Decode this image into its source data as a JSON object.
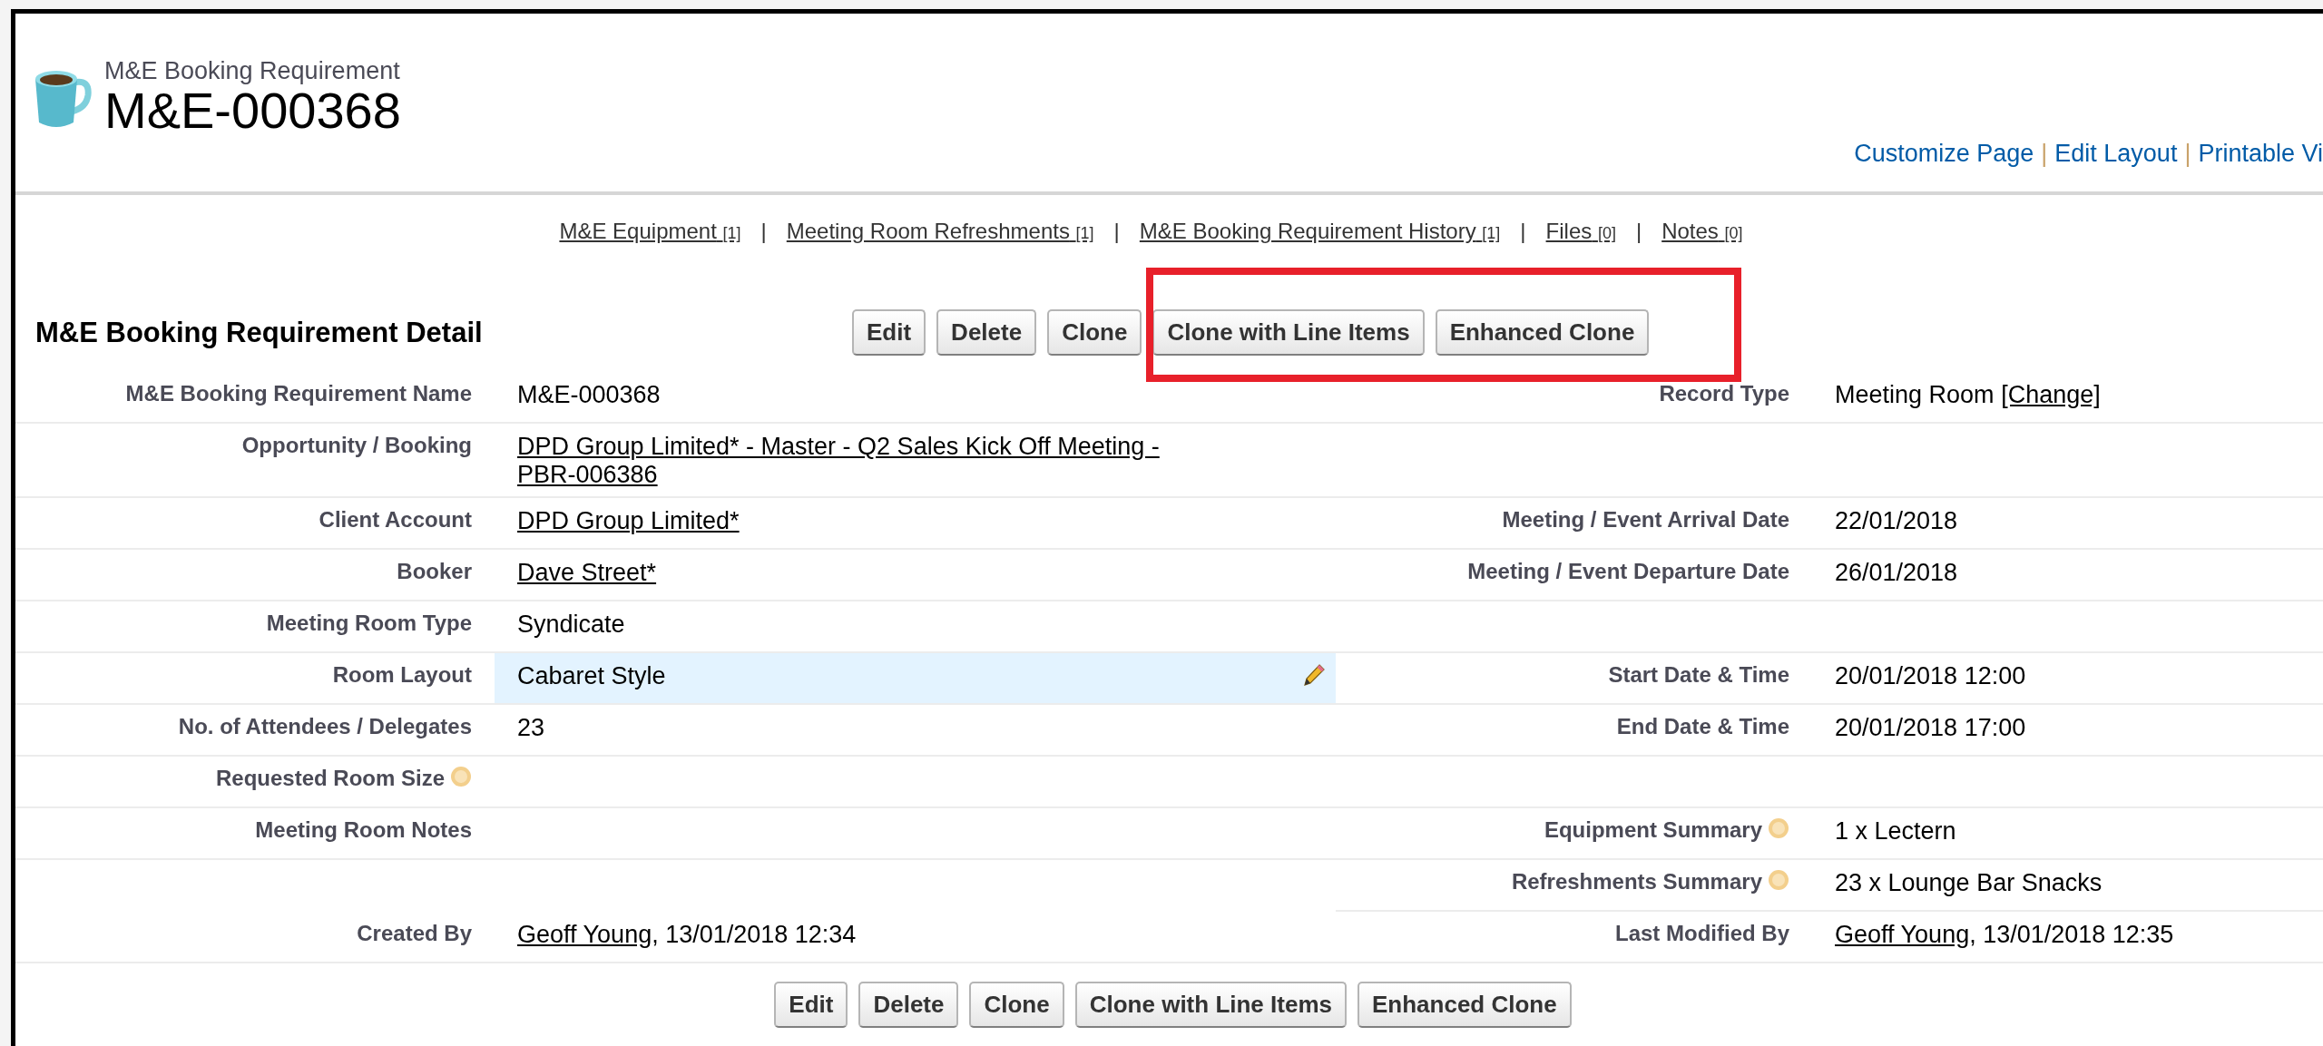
{
  "header": {
    "object_type": "M&E Booking Requirement",
    "record_name": "M&E-000368"
  },
  "top_links": [
    "Customize Page",
    "Edit Layout",
    "Printable Vi"
  ],
  "top_links_separator": "|",
  "related_separator": "|",
  "related_lists": [
    {
      "label": "M&E Equipment",
      "count": "[1]"
    },
    {
      "label": "Meeting Room Refreshments",
      "count": "[1]"
    },
    {
      "label": "M&E Booking Requirement History",
      "count": "[1]"
    },
    {
      "label": "Files",
      "count": "[0]"
    },
    {
      "label": "Notes",
      "count": "[0]"
    }
  ],
  "detail": {
    "title": "M&E Booking Requirement Detail",
    "buttons": [
      "Edit",
      "Delete",
      "Clone",
      "Clone with Line Items",
      "Enhanced Clone"
    ],
    "rows": [
      {
        "left": {
          "label": "M&E Booking Requirement Name",
          "help": false,
          "highlighted": false,
          "value": [
            {
              "text": "M&E-000368",
              "link": false
            }
          ]
        },
        "right": {
          "label": "Record Type",
          "help": false,
          "highlighted": false,
          "value": [
            {
              "text": "Meeting Room",
              "link": false
            },
            {
              "text": "[Change]",
              "link": true
            }
          ]
        }
      },
      {
        "left": {
          "label": "Opportunity / Booking",
          "help": false,
          "highlighted": false,
          "value": [
            {
              "text": "DPD Group Limited* - Master - Q2 Sales Kick Off Meeting - PBR-006386",
              "link": true
            }
          ]
        },
        "right": {
          "help": false,
          "highlighted": false
        }
      },
      {
        "left": {
          "label": "Client Account",
          "help": false,
          "highlighted": false,
          "value": [
            {
              "text": "DPD Group Limited*",
              "link": true
            }
          ]
        },
        "right": {
          "label": "Meeting / Event Arrival Date",
          "help": false,
          "highlighted": false,
          "value": [
            {
              "text": "22/01/2018",
              "link": false
            }
          ]
        }
      },
      {
        "left": {
          "label": "Booker",
          "help": false,
          "highlighted": false,
          "value": [
            {
              "text": "Dave Street*",
              "link": true
            }
          ]
        },
        "right": {
          "label": "Meeting / Event Departure Date",
          "help": false,
          "highlighted": false,
          "value": [
            {
              "text": "26/01/2018",
              "link": false
            }
          ]
        }
      },
      {
        "left": {
          "label": "Meeting Room Type",
          "help": false,
          "highlighted": false,
          "value": [
            {
              "text": "Syndicate",
              "link": false
            }
          ]
        },
        "right": {
          "help": false,
          "highlighted": false
        }
      },
      {
        "left": {
          "label": "Room Layout",
          "help": false,
          "highlighted": true,
          "value": [
            {
              "text": "Cabaret Style",
              "link": false
            }
          ]
        },
        "right": {
          "label": "Start Date & Time",
          "help": false,
          "highlighted": false,
          "value": [
            {
              "text": "20/01/2018 12:00",
              "link": false
            }
          ]
        }
      },
      {
        "left": {
          "label": "No. of Attendees / Delegates",
          "help": false,
          "highlighted": false,
          "value": [
            {
              "text": "23",
              "link": false
            }
          ]
        },
        "right": {
          "label": "End Date & Time",
          "help": false,
          "highlighted": false,
          "value": [
            {
              "text": "20/01/2018 17:00",
              "link": false
            }
          ]
        }
      },
      {
        "left": {
          "label": "Requested Room Size",
          "help": true,
          "highlighted": false
        },
        "right": {
          "help": false,
          "highlighted": false
        }
      },
      {
        "left": {
          "label": "Meeting Room Notes",
          "help": false,
          "highlighted": false
        },
        "right": {
          "label": "Equipment Summary",
          "help": true,
          "highlighted": false,
          "value": [
            {
              "text": "1 x Lectern",
              "link": false
            }
          ]
        }
      },
      {
        "left": {
          "help": false,
          "highlighted": false
        },
        "right": {
          "label": "Refreshments Summary",
          "help": true,
          "highlighted": false,
          "value": [
            {
              "text": "23 x Lounge Bar Snacks",
              "link": false
            }
          ]
        }
      },
      {
        "left": {
          "label": "Created By",
          "help": false,
          "highlighted": false,
          "value": [
            {
              "text": "Geoff Young",
              "link": true
            },
            {
              "text": ", 13/01/2018 12:34",
              "link": false
            }
          ]
        },
        "right": {
          "label": "Last Modified By",
          "help": false,
          "highlighted": false,
          "value": [
            {
              "text": "Geoff Young",
              "link": true
            },
            {
              "text": ", 13/01/2018 12:35",
              "link": false
            }
          ]
        }
      }
    ]
  },
  "bottom_buttons": [
    "Edit",
    "Delete",
    "Clone",
    "Clone with Line Items",
    "Enhanced Clone"
  ]
}
